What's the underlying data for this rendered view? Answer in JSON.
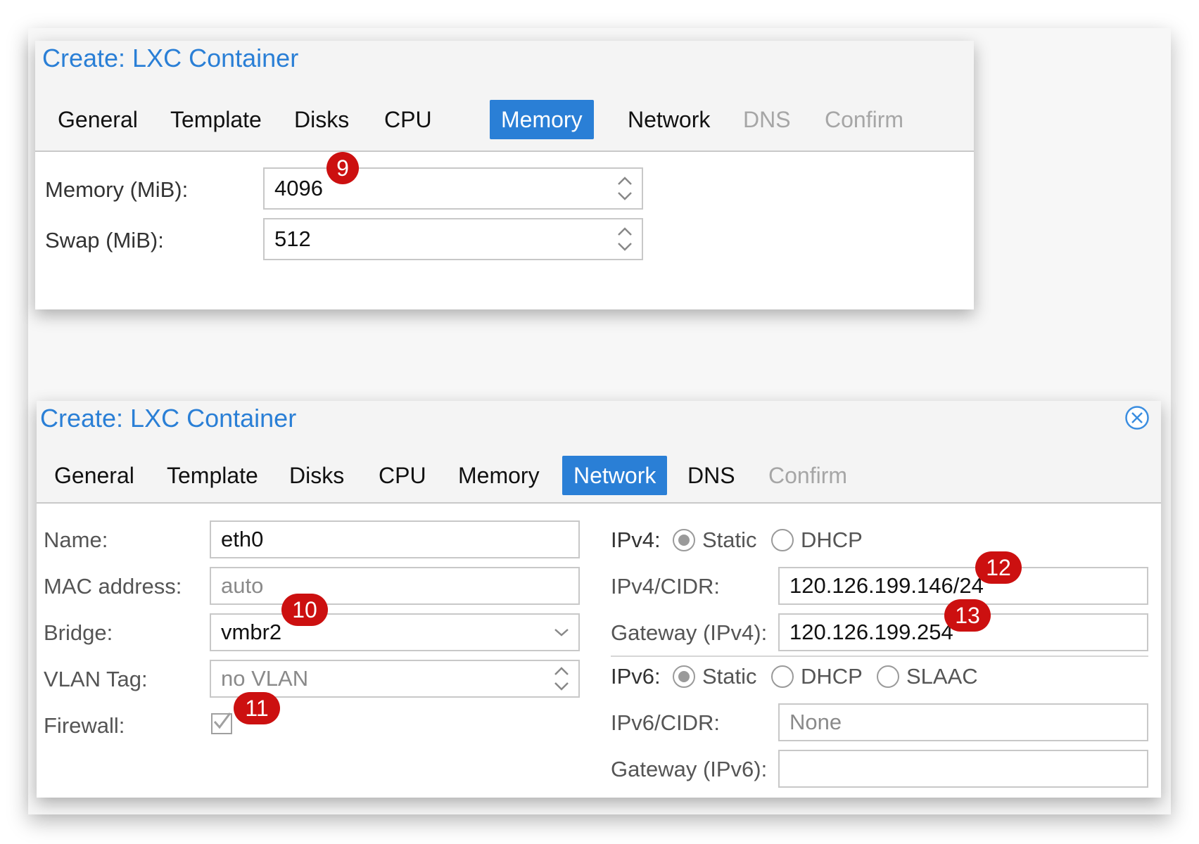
{
  "colors": {
    "accent": "#2a7fd6",
    "badge": "#cc1010",
    "disabled_text": "#a6a6a6"
  },
  "memory_dialog": {
    "title": "Create: LXC Container",
    "tabs": [
      "General",
      "Template",
      "Disks",
      "CPU",
      "Memory",
      "Network",
      "DNS",
      "Confirm"
    ],
    "active_tab": "Memory",
    "disabled_tabs": [
      "DNS",
      "Confirm"
    ],
    "memory_label": "Memory (MiB):",
    "memory_value": "4096",
    "swap_label": "Swap (MiB):",
    "swap_value": "512",
    "badge_9": "9"
  },
  "network_dialog": {
    "title": "Create: LXC Container",
    "tabs": [
      "General",
      "Template",
      "Disks",
      "CPU",
      "Memory",
      "Network",
      "DNS",
      "Confirm"
    ],
    "active_tab": "Network",
    "disabled_tabs": [
      "Confirm"
    ],
    "name_label": "Name:",
    "name_value": "eth0",
    "mac_label": "MAC address:",
    "mac_placeholder": "auto",
    "bridge_label": "Bridge:",
    "bridge_value": "vmbr2",
    "vlan_label": "VLAN Tag:",
    "vlan_placeholder": "no VLAN",
    "firewall_label": "Firewall:",
    "firewall_checked": true,
    "ipv4_label": "IPv4:",
    "ipv4_options": [
      "Static",
      "DHCP"
    ],
    "ipv4_selected": "Static",
    "ipv4_cidr_label": "IPv4/CIDR:",
    "ipv4_cidr_value": "120.126.199.146/24",
    "gateway_ipv4_label": "Gateway (IPv4):",
    "gateway_ipv4_value": "120.126.199.254",
    "ipv6_label": "IPv6:",
    "ipv6_options": [
      "Static",
      "DHCP",
      "SLAAC"
    ],
    "ipv6_selected": "Static",
    "ipv6_cidr_label": "IPv6/CIDR:",
    "ipv6_cidr_placeholder": "None",
    "gateway_ipv6_label": "Gateway (IPv6):",
    "gateway_ipv6_value": "",
    "badge_10": "10",
    "badge_11": "11",
    "badge_12": "12",
    "badge_13": "13"
  },
  "icons": {
    "close": "close-circle-icon",
    "spinner": "spinner-arrows-icon",
    "dropdown": "chevron-down-icon",
    "checkmark": "checkmark-icon"
  }
}
